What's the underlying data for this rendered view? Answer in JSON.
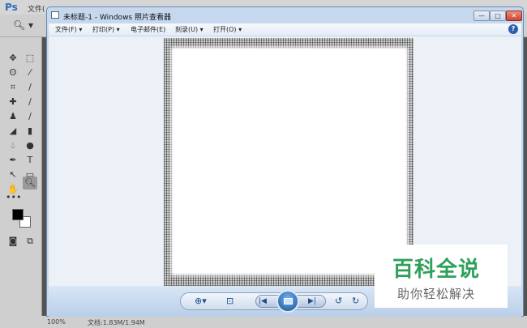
{
  "photoshop": {
    "logo": "Ps",
    "menu_first": "文件(",
    "status_zoom": "100%",
    "status_doc": "文档:1.83M/1.94M"
  },
  "viewer": {
    "title": "未标题-1 - Windows 照片查看器",
    "window_buttons": {
      "minimize": "—",
      "maximize": "□",
      "close": "✕"
    },
    "menu": [
      {
        "label": "文件(F)"
      },
      {
        "label": "打印(P)"
      },
      {
        "label": "电子邮件(E)"
      },
      {
        "label": "刻录(U)"
      },
      {
        "label": "打开(O)"
      }
    ],
    "help": "?",
    "controls": {
      "zoom": "⊕▾",
      "fit": "⊡",
      "prev": "|◀",
      "next": "▶|",
      "rotate_left": "↺",
      "rotate_right": "↻"
    }
  },
  "watermark": {
    "line1": "百科全说",
    "line2": "助你轻松解决"
  }
}
